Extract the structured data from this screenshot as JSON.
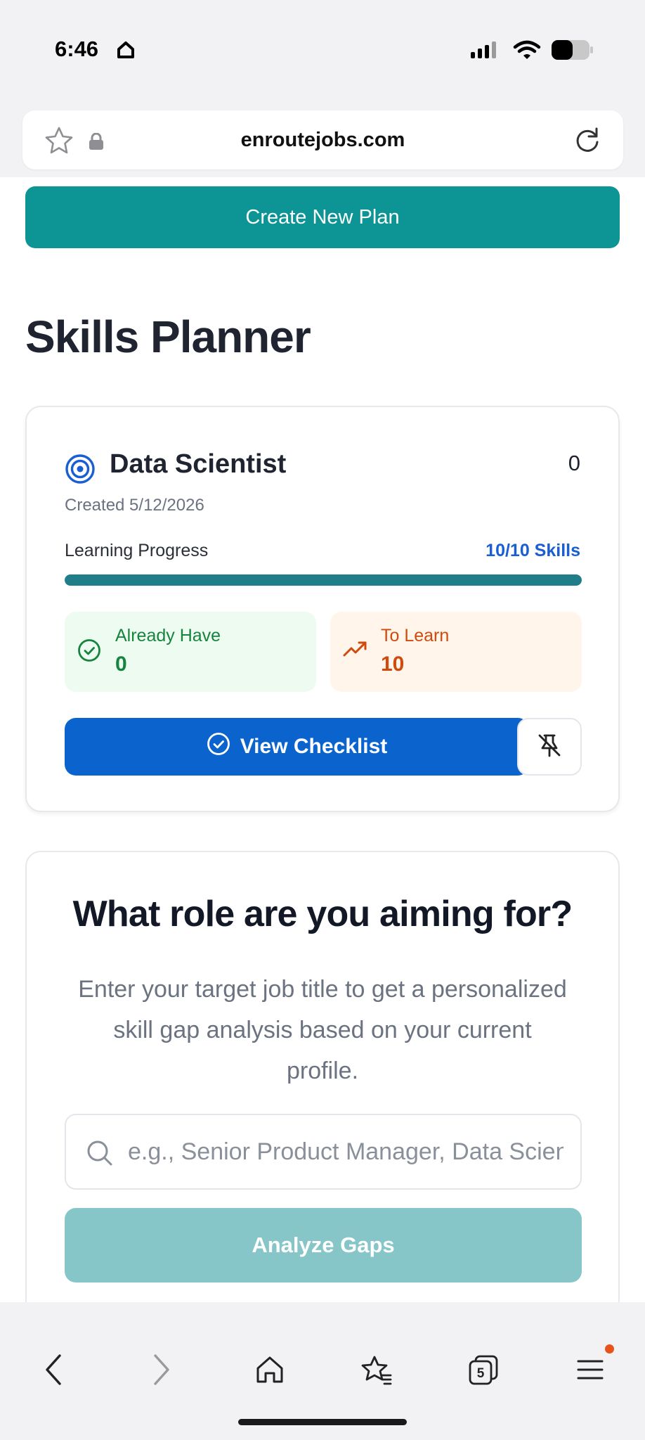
{
  "status_bar": {
    "time": "6:46"
  },
  "browser": {
    "url": "enroutejobs.com",
    "tab_count": "5"
  },
  "actions": {
    "create_plan": "Create New Plan"
  },
  "page": {
    "title": "Skills Planner"
  },
  "plan_card": {
    "role": "Data Scientist",
    "count": "0",
    "created": "Created 5/12/2026",
    "progress_label": "Learning Progress",
    "progress_skills": "10/10 Skills",
    "progress_fraction": 1.0,
    "already_have_label": "Already Have",
    "already_have_value": "0",
    "to_learn_label": "To Learn",
    "to_learn_value": "10",
    "checklist_button": "View Checklist"
  },
  "role_form": {
    "title": "What role are you aiming for?",
    "description": "Enter your target job title to get a personalized skill gap analysis based on your current profile.",
    "input_placeholder": "e.g., Senior Product Manager, Data Scientist",
    "analyze_button": "Analyze Gaps"
  },
  "colors": {
    "teal": "#0d9494",
    "blue": "#0b63ce",
    "green": "#17843e",
    "orange": "#cf4a0c"
  }
}
